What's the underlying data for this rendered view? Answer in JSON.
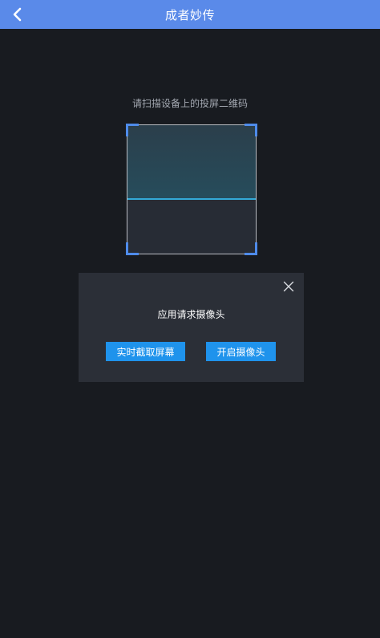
{
  "header": {
    "title": "成者妙传",
    "back_icon": "chevron-left-icon"
  },
  "scanner": {
    "instruction": "请扫描设备上的投屏二维码"
  },
  "dialog": {
    "message": "应用请求摄像头",
    "close_icon": "close-icon",
    "screen_capture_label": "实时截取屏幕",
    "open_camera_label": "开启摄像头"
  },
  "colors": {
    "header_bg": "#5a8ae9",
    "page_bg": "#181b20",
    "dialog_bg": "#2b2f37",
    "button_bg": "#1f93ec",
    "corner_accent": "#4e8bea",
    "scan_line": "#33a9d7"
  }
}
